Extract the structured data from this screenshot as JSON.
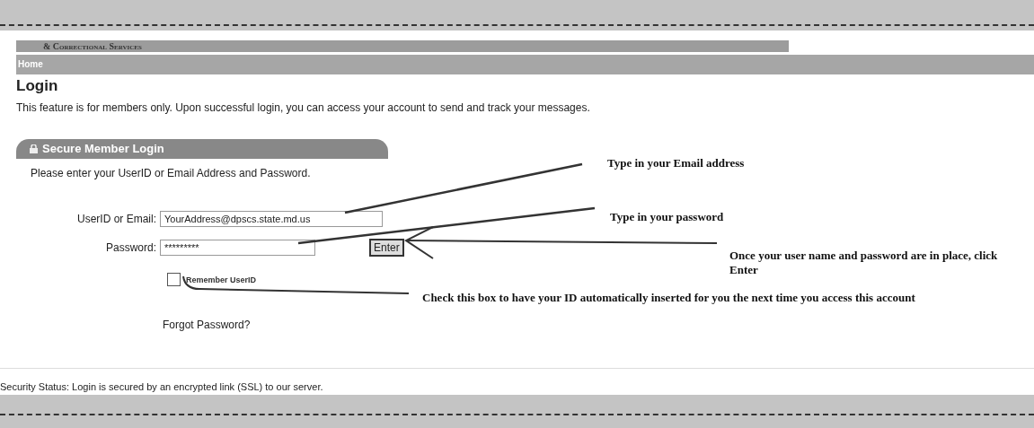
{
  "header": {
    "agency": "& Correctional Services"
  },
  "nav": {
    "home": "Home"
  },
  "page": {
    "title": "Login",
    "intro": "This feature is for members only. Upon successful login, you can access your account to send and track your messages."
  },
  "login_panel": {
    "title": "Secure Member Login",
    "instruction": "Please enter your UserID or Email Address and Password.",
    "fields": [
      {
        "label": "UserID or Email:",
        "value": "YourAddress@dpscs.state.md.us"
      },
      {
        "label": "Password:",
        "value": "*********"
      }
    ],
    "submit": "Enter",
    "remember": {
      "label": "Remember UserID",
      "checked": false
    },
    "forgot": "Forgot Password?"
  },
  "security_status": "Security Status: Login is secured by an encrypted link (SSL) to our server.",
  "annotations": [
    {
      "text": "Type in your Email address"
    },
    {
      "text": "Type in your password"
    },
    {
      "text": "Once your user name and password are in place, click Enter"
    },
    {
      "text": "Check this box to have your ID automatically inserted for you the next time you access this account"
    }
  ]
}
